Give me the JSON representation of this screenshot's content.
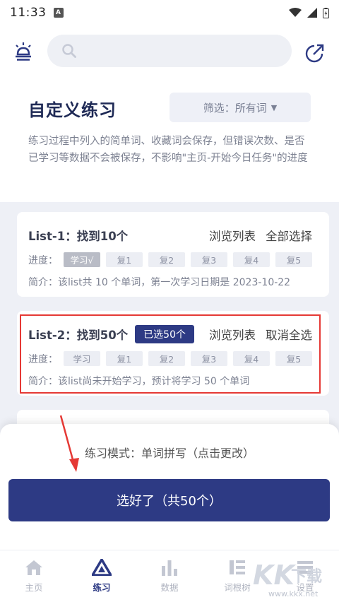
{
  "status": {
    "time": "11:33",
    "sim_label": "A"
  },
  "search": {
    "placeholder": ""
  },
  "header": {
    "title": "自定义练习",
    "filter_label": "筛选：所有词",
    "filter_arrow": "▼",
    "description": "练习过程中列入的简单词、收藏词会保存，但错误次数、是否已学习等数据不会被保存，不影响\"主页-开始今日任务\"的进度"
  },
  "lists": [
    {
      "name": "List-1：找到10个",
      "badge": "",
      "browse": "浏览列表",
      "select": "全部选择",
      "progress_label": "进度：",
      "stages": [
        "学习√",
        "复1",
        "复2",
        "复3",
        "复4",
        "复5"
      ],
      "done_stages": 1,
      "intro": "简介：该list共 10 个单词，第一次学习日期是 2023-10-22"
    },
    {
      "name": "List-2：找到50个",
      "badge": "已选50个",
      "browse": "浏览列表",
      "select": "取消全选",
      "progress_label": "进度：",
      "stages": [
        "学习",
        "复1",
        "复2",
        "复3",
        "复4",
        "复5"
      ],
      "done_stages": 0,
      "intro": "简介：该list尚未开始学习，预计将学习 50 个单词"
    }
  ],
  "panel": {
    "mode_text": "练习模式：单词拼写（点击更改）",
    "confirm_label": "选好了（共50个）"
  },
  "nav": [
    {
      "label": "主页",
      "icon": "home-icon",
      "active": false
    },
    {
      "label": "练习",
      "icon": "practice-icon",
      "active": true
    },
    {
      "label": "数据",
      "icon": "stats-icon",
      "active": false
    },
    {
      "label": "词根树",
      "icon": "tree-icon",
      "active": false
    },
    {
      "label": "设置",
      "icon": "settings-icon",
      "active": false
    }
  ],
  "watermark": {
    "brand": "KK",
    "text": "下载",
    "url": "www.kkx.net"
  },
  "colors": {
    "primary": "#2d3a84",
    "highlight": "#e53935",
    "background_list": "#eef0f6"
  }
}
